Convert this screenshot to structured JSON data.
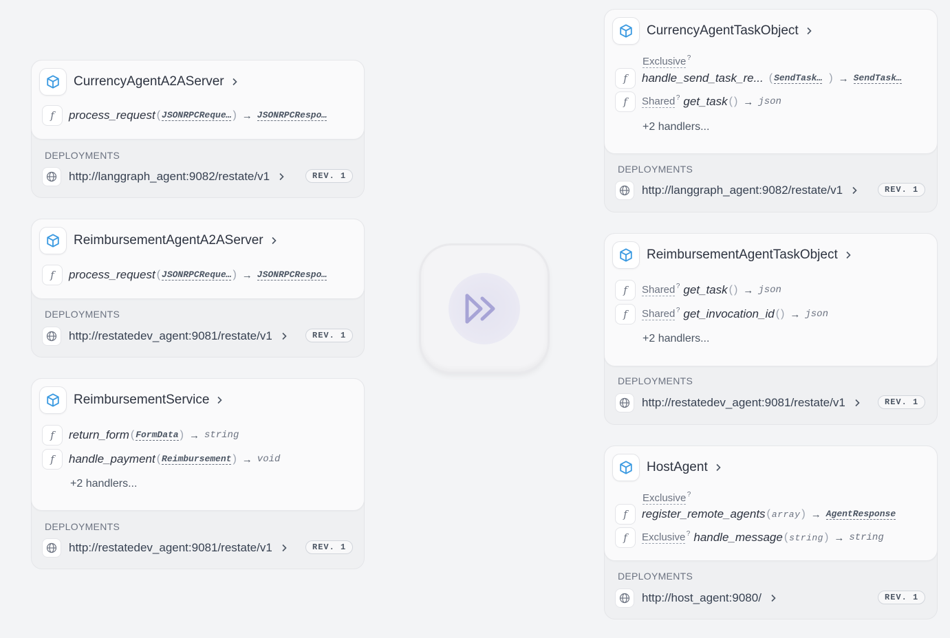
{
  "labels": {
    "deployments": "DEPLOYMENTS"
  },
  "center_logo": {
    "icon": "restate-logo-icon",
    "color": "#a7a4d6"
  },
  "services": [
    {
      "name": "CurrencyAgentA2AServer",
      "handlers": [
        {
          "name": "process_request",
          "open": "(",
          "param": "JSONRPCReque…",
          "close": ")",
          "arrow": "→",
          "ret": "JSONRPCRespo…"
        }
      ],
      "deployment": {
        "url": "http://langgraph_agent:9082/restate/v1",
        "rev": "REV. 1"
      }
    },
    {
      "name": "ReimbursementAgentA2AServer",
      "handlers": [
        {
          "name": "process_request",
          "open": "(",
          "param": "JSONRPCReque…",
          "close": ")",
          "arrow": "→",
          "ret": "JSONRPCRespo…"
        }
      ],
      "deployment": {
        "url": "http://restatedev_agent:9081/restate/v1",
        "rev": "REV. 1"
      }
    },
    {
      "name": "ReimbursementService",
      "handlers": [
        {
          "name": "return_form",
          "open": "(",
          "param": "FormData",
          "close": ")",
          "arrow": "→",
          "ret": "string"
        },
        {
          "name": "handle_payment",
          "open": "(",
          "param": "Reimbursement",
          "close": ")",
          "arrow": "→",
          "ret": "void"
        }
      ],
      "more": "+2 handlers...",
      "deployment": {
        "url": "http://restatedev_agent:9081/restate/v1",
        "rev": "REV. 1"
      }
    },
    {
      "name": "CurrencyAgentTaskObject",
      "handlers": [
        {
          "kind": "Exclusive",
          "kind_sup": "?",
          "name": "handle_send_task_re...",
          "open": "(",
          "param": "SendTask…",
          "close": ")",
          "arrow": "→",
          "ret": "SendTask…"
        },
        {
          "kind": "Shared",
          "kind_sup": "?",
          "name": "get_task",
          "open": "(",
          "close": ")",
          "arrow": "→",
          "ret": "json"
        }
      ],
      "more": "+2 handlers...",
      "deployment": {
        "url": "http://langgraph_agent:9082/restate/v1",
        "rev": "REV. 1"
      }
    },
    {
      "name": "ReimbursementAgentTaskObject",
      "handlers": [
        {
          "kind": "Shared",
          "kind_sup": "?",
          "name": "get_task",
          "open": "(",
          "close": ")",
          "arrow": "→",
          "ret": "json"
        },
        {
          "kind": "Shared",
          "kind_sup": "?",
          "name": "get_invocation_id",
          "open": "(",
          "close": ")",
          "arrow": "→",
          "ret": "json"
        }
      ],
      "more": "+2 handlers...",
      "deployment": {
        "url": "http://restatedev_agent:9081/restate/v1",
        "rev": "REV. 1"
      }
    },
    {
      "name": "HostAgent",
      "handlers": [
        {
          "kind": "Exclusive",
          "kind_sup": "?",
          "name": "register_remote_agents",
          "open": "(",
          "param": "array",
          "close": ")",
          "arrow": "→",
          "ret": "AgentResponse"
        },
        {
          "kind": "Exclusive",
          "kind_sup": "?",
          "name": "handle_message",
          "open": "(",
          "param": "string",
          "close": ")",
          "arrow": "→",
          "ret": "string"
        }
      ],
      "deployment": {
        "url": "http://host_agent:9080/",
        "rev": "REV. 1"
      }
    }
  ],
  "icons": {
    "service": "cube-icon",
    "handler": "function-icon",
    "deployment": "globe-icon",
    "chevron": "chevron-right-icon",
    "service_color": "#3b9ae1"
  }
}
